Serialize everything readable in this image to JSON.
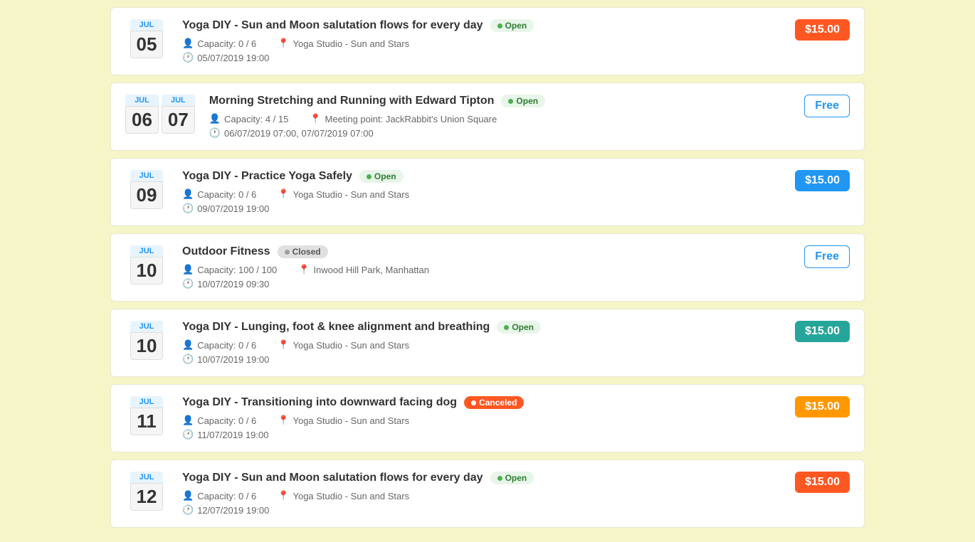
{
  "events": [
    {
      "id": 1,
      "month": "JUL",
      "day": "05",
      "multi_date": false,
      "title": "Yoga DIY - Sun and Moon salutation flows for every day",
      "status": "Open",
      "status_type": "open",
      "capacity": "Capacity: 0 / 6",
      "location": "Yoga Studio - Sun and Stars",
      "datetime": "05/07/2019 19:00",
      "price": "$15.00",
      "price_type": "paid_red"
    },
    {
      "id": 2,
      "month": "JUL",
      "day": "06",
      "month2": "JUL",
      "day2": "07",
      "multi_date": true,
      "title": "Morning Stretching and Running with Edward Tipton",
      "status": "Open",
      "status_type": "open",
      "capacity": "Capacity: 4 / 15",
      "location": "Meeting point: JackRabbit's Union Square",
      "datetime": "06/07/2019 07:00, 07/07/2019 07:00",
      "price": "Free",
      "price_type": "free"
    },
    {
      "id": 3,
      "month": "JUL",
      "day": "09",
      "multi_date": false,
      "title": "Yoga DIY - Practice Yoga Safely",
      "status": "Open",
      "status_type": "open",
      "capacity": "Capacity: 0 / 6",
      "location": "Yoga Studio - Sun and Stars",
      "datetime": "09/07/2019 19:00",
      "price": "$15.00",
      "price_type": "paid_blue"
    },
    {
      "id": 4,
      "month": "JUL",
      "day": "10",
      "multi_date": false,
      "title": "Outdoor Fitness",
      "status": "Closed",
      "status_type": "closed",
      "capacity": "Capacity: 100 / 100",
      "location": "Inwood Hill Park, Manhattan",
      "datetime": "10/07/2019 09:30",
      "price": "Free",
      "price_type": "free"
    },
    {
      "id": 5,
      "month": "JUL",
      "day": "10",
      "multi_date": false,
      "title": "Yoga DIY - Lunging, foot & knee alignment and breathing",
      "status": "Open",
      "status_type": "open",
      "capacity": "Capacity: 0 / 6",
      "location": "Yoga Studio - Sun and Stars",
      "datetime": "10/07/2019 19:00",
      "price": "$15.00",
      "price_type": "paid_teal"
    },
    {
      "id": 6,
      "month": "JUL",
      "day": "11",
      "multi_date": false,
      "title": "Yoga DIY - Transitioning into downward facing dog",
      "status": "Canceled",
      "status_type": "canceled",
      "capacity": "Capacity: 0 / 6",
      "location": "Yoga Studio - Sun and Stars",
      "datetime": "11/07/2019 19:00",
      "price": "$15.00",
      "price_type": "paid_orange"
    },
    {
      "id": 7,
      "month": "JUL",
      "day": "12",
      "multi_date": false,
      "title": "Yoga DIY - Sun and Moon salutation flows for every day",
      "status": "Open",
      "status_type": "open",
      "capacity": "Capacity: 0 / 6",
      "location": "Yoga Studio - Sun and Stars",
      "datetime": "12/07/2019 19:00",
      "price": "$15.00",
      "price_type": "paid_red"
    }
  ],
  "icons": {
    "person": "👤",
    "location": "📍",
    "clock": "🕐"
  }
}
